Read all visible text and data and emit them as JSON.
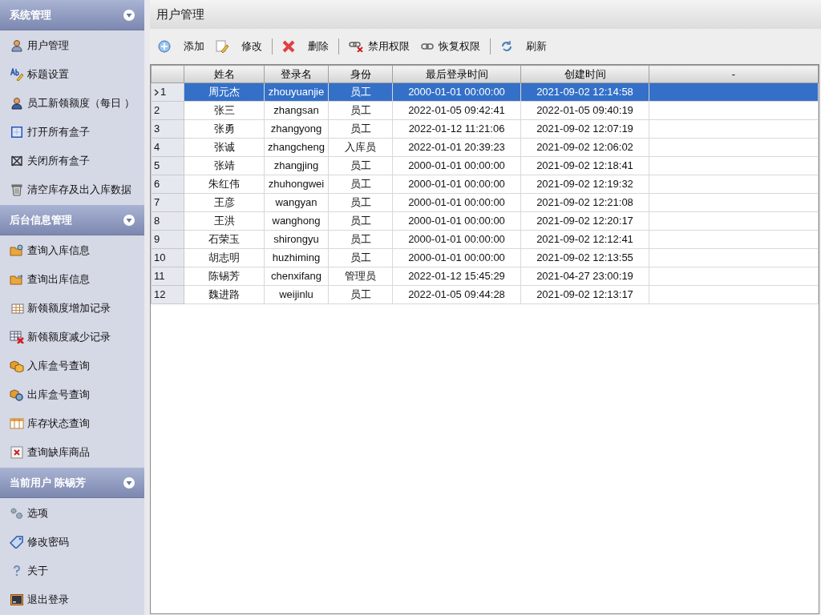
{
  "sidebar": {
    "sections": [
      {
        "title": "系统管理",
        "expanded": true,
        "items": [
          "用户管理",
          "标题设置",
          "员工新领额度（每日 ）",
          "打开所有盒子",
          "关闭所有盒子",
          "清空库存及出入库数据"
        ]
      },
      {
        "title": "后台信息管理",
        "expanded": true,
        "items": [
          "查询入库信息",
          "查询出库信息",
          "新领额度增加记录",
          "新领额度减少记录",
          "入库盒号查询",
          "出库盒号查询",
          "库存状态查询",
          "查询缺库商品"
        ]
      },
      {
        "title": "当前用户 陈锡芳",
        "expanded": true,
        "items": [
          "选项",
          "修改密码",
          "关于",
          "退出登录"
        ]
      }
    ]
  },
  "page_title": "用户管理",
  "toolbar": [
    {
      "label": "添加",
      "separator_after": false
    },
    {
      "label": "修改",
      "separator_after": true
    },
    {
      "label": "删除",
      "separator_after": true
    },
    {
      "label": "禁用权限",
      "separator_after": false
    },
    {
      "label": "恢复权限",
      "separator_after": true
    },
    {
      "label": "刷新",
      "separator_after": false
    }
  ],
  "table": {
    "columns": [
      "姓名",
      "登录名",
      "身份",
      "最后登录时间",
      "创建时间",
      "-"
    ],
    "rows": [
      {
        "number": "1",
        "selected": true,
        "cells": [
          "周元杰",
          "zhouyuanjie",
          "员工",
          "2000-01-01 00:00:00",
          "2021-09-02 12:14:58"
        ]
      },
      {
        "number": "2",
        "selected": false,
        "cells": [
          "张三",
          "zhangsan",
          "员工",
          "2022-01-05 09:42:41",
          "2022-01-05 09:40:19"
        ]
      },
      {
        "number": "3",
        "selected": false,
        "cells": [
          "张勇",
          "zhangyong",
          "员工",
          "2022-01-12 11:21:06",
          "2021-09-02 12:07:19"
        ]
      },
      {
        "number": "4",
        "selected": false,
        "cells": [
          "张诚",
          "zhangcheng",
          "入库员",
          "2022-01-01 20:39:23",
          "2021-09-02 12:06:02"
        ]
      },
      {
        "number": "5",
        "selected": false,
        "cells": [
          "张靖",
          "zhangjing",
          "员工",
          "2000-01-01 00:00:00",
          "2021-09-02 12:18:41"
        ]
      },
      {
        "number": "6",
        "selected": false,
        "cells": [
          "朱红伟",
          "zhuhongwei",
          "员工",
          "2000-01-01 00:00:00",
          "2021-09-02 12:19:32"
        ]
      },
      {
        "number": "7",
        "selected": false,
        "cells": [
          "王彦",
          "wangyan",
          "员工",
          "2000-01-01 00:00:00",
          "2021-09-02 12:21:08"
        ]
      },
      {
        "number": "8",
        "selected": false,
        "cells": [
          "王洪",
          "wanghong",
          "员工",
          "2000-01-01 00:00:00",
          "2021-09-02 12:20:17"
        ]
      },
      {
        "number": "9",
        "selected": false,
        "cells": [
          "石荣玉",
          "shirongyu",
          "员工",
          "2000-01-01 00:00:00",
          "2021-09-02 12:12:41"
        ]
      },
      {
        "number": "10",
        "selected": false,
        "cells": [
          "胡志明",
          "huzhiming",
          "员工",
          "2000-01-01 00:00:00",
          "2021-09-02 12:13:55"
        ]
      },
      {
        "number": "11",
        "selected": false,
        "cells": [
          "陈锡芳",
          "chenxifang",
          "管理员",
          "2022-01-12 15:45:29",
          "2021-04-27 23:00:19"
        ]
      },
      {
        "number": "12",
        "selected": false,
        "cells": [
          "魏进路",
          "weijinlu",
          "员工",
          "2022-01-05 09:44:28",
          "2021-09-02 12:13:17"
        ]
      }
    ]
  }
}
